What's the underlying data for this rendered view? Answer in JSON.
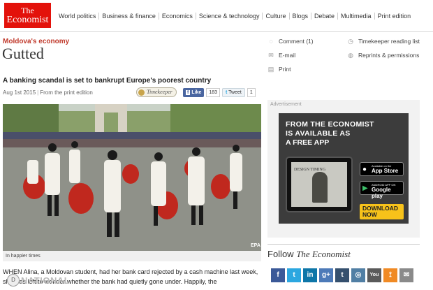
{
  "logo": {
    "line1": "The",
    "line2": "Economist"
  },
  "nav": [
    "World politics",
    "Business & finance",
    "Economics",
    "Science & technology",
    "Culture",
    "Blogs",
    "Debate",
    "Multimedia",
    "Print edition"
  ],
  "article": {
    "section": "Moldova's economy",
    "headline": "Gutted",
    "standfirst": "A banking scandal is set to bankrupt Europe's poorest country",
    "date": "Aug 1st 2015",
    "source": "From the print edition",
    "caption": "In happier times",
    "photo_credit": "EPA",
    "body": "WHEN Alina, a Moldovan student, had her bank card rejected by a cash machine last week, she was left to wonder whether the bank had quietly gone under. Happily, the"
  },
  "share": {
    "timekeeper": "Timekeeper",
    "fb_label": "Like",
    "fb_icon": "f",
    "fb_count": "183",
    "tw_label": "Tweet",
    "tw_icon": "t",
    "tw_count": "1"
  },
  "tools": {
    "comment": "Comment (1)",
    "email": "E-mail",
    "print": "Print",
    "timekeeper_list": "Timekeeper reading list",
    "reprints": "Reprints & permissions"
  },
  "ad": {
    "label": "Advertisement",
    "line1": "FROM THE ECONOMIST",
    "line2": "IS AVAILABLE AS",
    "line3": "A FREE APP",
    "tablet_text": "DESIGN TIMING",
    "appstore_small": "Available on the",
    "appstore_big": "App Store",
    "google_small": "ANDROID APP ON",
    "google_big": "Google play",
    "download": "DOWNLOAD NOW"
  },
  "follow": {
    "prefix": "Follow ",
    "brand": "The Economist"
  },
  "social": [
    {
      "name": "facebook",
      "glyph": "f",
      "color": "#3b5998"
    },
    {
      "name": "twitter",
      "glyph": "t",
      "color": "#2ca7e0"
    },
    {
      "name": "linkedin",
      "glyph": "in",
      "color": "#0e76a8"
    },
    {
      "name": "google-plus",
      "glyph": "g+",
      "color": "#4d7ab8"
    },
    {
      "name": "tumblr",
      "glyph": "t",
      "color": "#35506e"
    },
    {
      "name": "instagram",
      "glyph": "◎",
      "color": "#517fa4"
    },
    {
      "name": "youtube",
      "glyph": "You",
      "color": "#5a5a5a"
    },
    {
      "name": "rss",
      "glyph": "⟟",
      "color": "#f08a24"
    },
    {
      "name": "email",
      "glyph": "✉",
      "color": "#8a8a8a"
    }
  ],
  "watermark": {
    "symbol": "D",
    "text": "NATIONAL"
  }
}
